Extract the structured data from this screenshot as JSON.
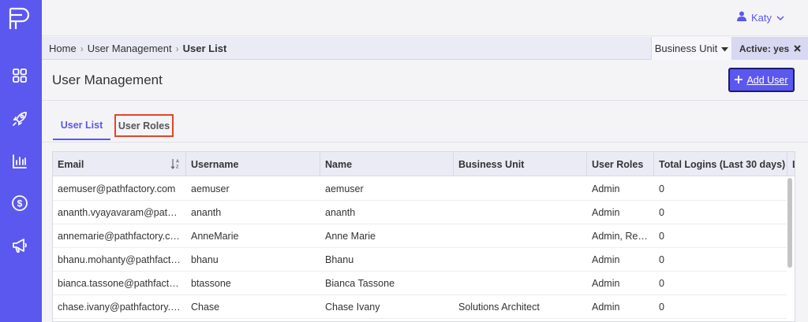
{
  "user": {
    "name": "Katy"
  },
  "breadcrumb": {
    "home": "Home",
    "section": "User Management",
    "current": "User List"
  },
  "filters": {
    "business_unit": "Business Unit",
    "active": "Active: yes"
  },
  "page": {
    "title": "User Management",
    "add_user": "Add User"
  },
  "tabs": {
    "user_list": "User List",
    "user_roles": "User Roles"
  },
  "table": {
    "headers": {
      "email": "Email",
      "username": "Username",
      "name": "Name",
      "business_unit": "Business Unit",
      "user_roles": "User Roles",
      "total_logins": "Total Logins (Last 30 days)",
      "last": "L"
    },
    "rows": [
      {
        "email": "aemuser@pathfactory.com",
        "username": "aemuser",
        "name": "aemuser",
        "business_unit": "",
        "user_roles": "Admin",
        "total_logins": "0"
      },
      {
        "email": "ananth.vyayavaram@pathfac...",
        "username": "ananth",
        "name": "ananth",
        "business_unit": "",
        "user_roles": "Admin",
        "total_logins": "0"
      },
      {
        "email": "annemarie@pathfactory.com",
        "username": "AnneMarie",
        "name": "Anne Marie",
        "business_unit": "",
        "user_roles": "Admin, Reve...",
        "total_logins": "0"
      },
      {
        "email": "bhanu.mohanty@pathfactory...",
        "username": "bhanu",
        "name": "Bhanu",
        "business_unit": "",
        "user_roles": "Admin",
        "total_logins": "0"
      },
      {
        "email": "bianca.tassone@pathfactory...",
        "username": "btassone",
        "name": "Bianca Tassone",
        "business_unit": "",
        "user_roles": "Admin",
        "total_logins": "0"
      },
      {
        "email": "chase.ivany@pathfactory.com",
        "username": "Chase",
        "name": "Chase Ivany",
        "business_unit": "Solutions Architect",
        "user_roles": "Admin",
        "total_logins": "0"
      }
    ]
  },
  "icons": {
    "logo": "pathfactory-logo-icon",
    "nav": [
      "dashboard-grid-icon",
      "rocket-icon",
      "analytics-bar-icon",
      "dollar-icon",
      "megaphone-icon"
    ],
    "user": "person-icon",
    "caret": "caret-down-icon",
    "close": "close-icon",
    "plus": "plus-icon",
    "sort": "sort-az-icon"
  },
  "colors": {
    "accent": "#5b58f0",
    "highlight_border": "#e2452b"
  }
}
